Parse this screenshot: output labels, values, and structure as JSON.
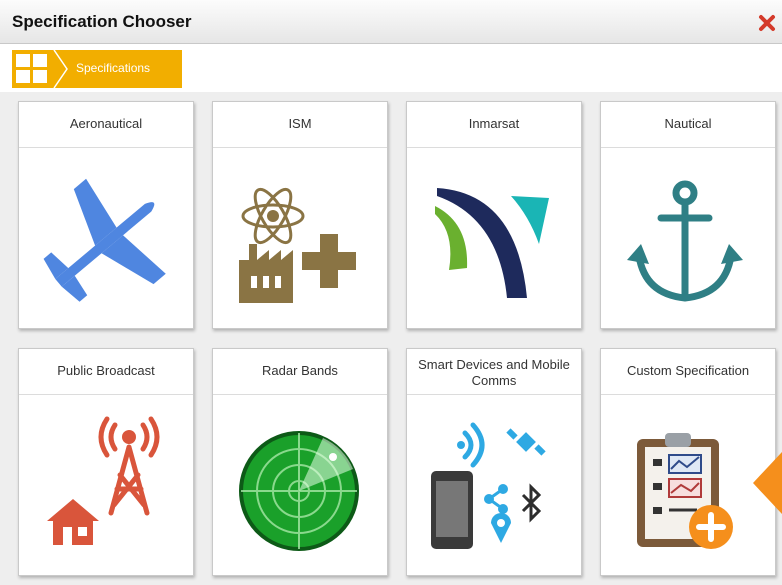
{
  "window": {
    "title": "Specification Chooser"
  },
  "breadcrumb": {
    "items": [
      {
        "label": "Specifications",
        "icon": "grid-icon"
      }
    ]
  },
  "tiles": [
    {
      "label": "Aeronautical",
      "icon": "airplane-icon"
    },
    {
      "label": "ISM",
      "icon": "industrial-scientific-medical-icon"
    },
    {
      "label": "Inmarsat",
      "icon": "inmarsat-logo-icon"
    },
    {
      "label": "Nautical",
      "icon": "anchor-icon"
    },
    {
      "label": "Public Broadcast",
      "icon": "broadcast-tower-icon"
    },
    {
      "label": "Radar Bands",
      "icon": "radar-icon"
    },
    {
      "label": "Smart Devices and Mobile Comms",
      "icon": "smart-devices-icon"
    },
    {
      "label": "Custom Specification",
      "icon": "custom-spec-clipboard-icon"
    }
  ],
  "colors": {
    "accent": "#f2ae00",
    "close": "#d43a2a",
    "airplane": "#4f86e0",
    "ism": "#8a7444",
    "inmarsat_navy": "#1e2a5c",
    "inmarsat_green": "#6ab02f",
    "inmarsat_teal": "#1ab5b5",
    "anchor": "#2f7f85",
    "broadcast": "#d9553b",
    "radar": "#1aa02a",
    "devices_blue": "#2ea9e3",
    "custom_orange": "#f58f1c"
  }
}
